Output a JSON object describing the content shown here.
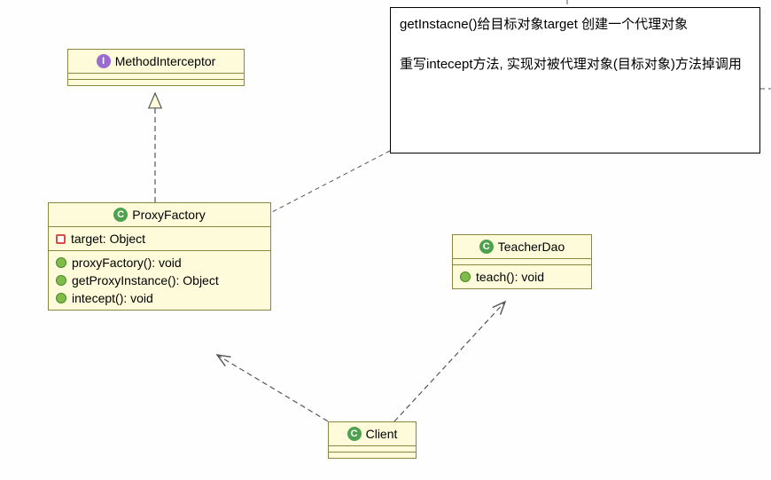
{
  "note": {
    "line1": "getInstacne()给目标对象target 创建一个代理对象",
    "line2": "重写intecept方法, 实现对被代理对象(目标对象)方法掉调用"
  },
  "classes": {
    "methodInterceptor": {
      "stereotype": "I",
      "name": "MethodInterceptor"
    },
    "proxyFactory": {
      "stereotype": "C",
      "name": "ProxyFactory",
      "attributes": [
        {
          "vis": "private",
          "text": "target: Object"
        }
      ],
      "operations": [
        {
          "vis": "public",
          "text": "proxyFactory(): void"
        },
        {
          "vis": "public",
          "text": "getProxyInstance(): Object"
        },
        {
          "vis": "public",
          "text": "intecept(): void"
        }
      ]
    },
    "teacherDao": {
      "stereotype": "C",
      "name": "TeacherDao",
      "operations": [
        {
          "vis": "public",
          "text": "teach(): void"
        }
      ]
    },
    "client": {
      "stereotype": "C",
      "name": "Client"
    }
  },
  "chart_data": {
    "type": "uml_class_diagram",
    "nodes": [
      {
        "id": "MethodInterceptor",
        "kind": "interface",
        "members": []
      },
      {
        "id": "ProxyFactory",
        "kind": "class",
        "attributes": [
          "- target: Object"
        ],
        "operations": [
          "+ proxyFactory(): void",
          "+ getProxyInstance(): Object",
          "+ intecept(): void"
        ]
      },
      {
        "id": "TeacherDao",
        "kind": "class",
        "operations": [
          "+ teach(): void"
        ]
      },
      {
        "id": "Client",
        "kind": "class"
      },
      {
        "id": "Note",
        "kind": "note",
        "text": "getInstacne()给目标对象target 创建一个代理对象\n\n重写intecept方法, 实现对被代理对象(目标对象)方法掉调用"
      }
    ],
    "edges": [
      {
        "from": "ProxyFactory",
        "to": "MethodInterceptor",
        "type": "realization"
      },
      {
        "from": "Client",
        "to": "ProxyFactory",
        "type": "dependency"
      },
      {
        "from": "Client",
        "to": "TeacherDao",
        "type": "dependency"
      },
      {
        "from": "Note",
        "to": "ProxyFactory",
        "type": "note-anchor"
      }
    ]
  }
}
